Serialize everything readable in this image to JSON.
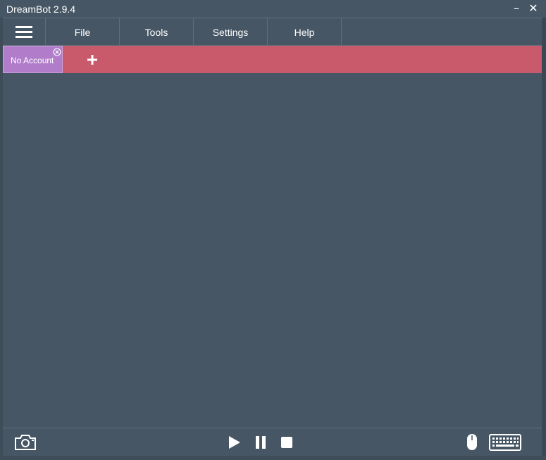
{
  "window": {
    "title": "DreamBot 2.9.4",
    "minimize_glyph": "–",
    "close_glyph": "✕"
  },
  "menu": {
    "items": [
      {
        "label": "File"
      },
      {
        "label": "Tools"
      },
      {
        "label": "Settings"
      },
      {
        "label": "Help"
      }
    ]
  },
  "tabs": {
    "items": [
      {
        "label": "No Account",
        "active": true
      }
    ],
    "add_icon": "plus-icon"
  },
  "colors": {
    "background": "#465664",
    "tabbar": "#c95a6c",
    "active_tab": "#b17dcb",
    "text": "#ffffff"
  },
  "bottom_toolbar": {
    "icons": [
      "camera-icon",
      "play-icon",
      "pause-icon",
      "stop-icon",
      "mouse-icon",
      "keyboard-icon"
    ]
  }
}
